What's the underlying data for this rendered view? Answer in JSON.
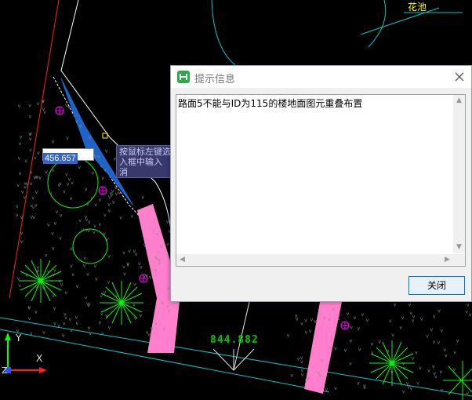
{
  "drawing": {
    "flower_bed_label": "花池",
    "elevation_label": "844.882",
    "dynamic_input_value": "456.657",
    "tooltip_text": "按鼠标左键选\n入框中输入\n消",
    "ucs": {
      "x_label": "X",
      "y_label": "Y",
      "z_label": "Z"
    },
    "colors": {
      "road_pink": "#ff7fcc",
      "selection_blue": "#1e64c8",
      "tree_green": "#00ff00",
      "magenta_mark": "#ff00ff",
      "cyan_line": "#00c8c8"
    }
  },
  "dialog": {
    "title": "提示信息",
    "message": "路面5不能与ID为115的楼地面图元重叠布置",
    "close_button_label": "关闭",
    "icons": {
      "app": "app-logo-icon",
      "close": "close-icon"
    }
  }
}
